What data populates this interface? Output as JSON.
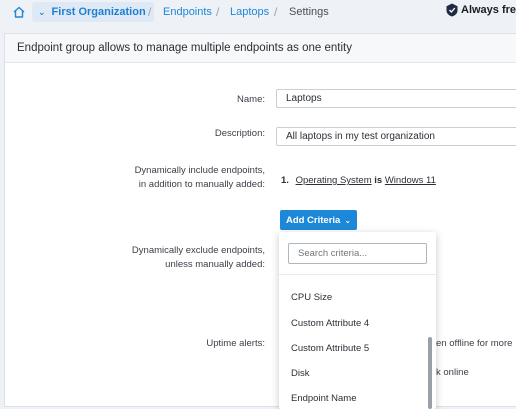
{
  "breadcrumb": {
    "organization": "First Organization",
    "items": [
      "Endpoints",
      "Laptops",
      "Settings"
    ],
    "separator": "/"
  },
  "plan_badge": "Always free:",
  "panel": {
    "title": "Endpoint group allows to manage multiple endpoints as one entity"
  },
  "form": {
    "name_label": "Name:",
    "name_value": "Laptops",
    "description_label": "Description:",
    "description_value": "All laptops in my test organization",
    "include_label_line1": "Dynamically include endpoints,",
    "include_label_line2": "in addition to manually added:",
    "include_rule": {
      "index": "1.",
      "field": "Operating System",
      "operator": "is",
      "value": "Windows 11"
    },
    "add_criteria_label": "Add Criteria",
    "exclude_label_line1": "Dynamically exclude endpoints,",
    "exclude_label_line2": "unless manually added:",
    "uptime_label": "Uptime alerts:",
    "uptime_text_1": "en offline for more",
    "uptime_text_2": "k online"
  },
  "dropdown": {
    "search_placeholder": "Search criteria...",
    "options": [
      "CPU Size",
      "Custom Attribute 4",
      "Custom Attribute 5",
      "Disk",
      "Endpoint Name"
    ]
  },
  "colors": {
    "accent": "#1e88d8",
    "page_bg": "#eef1f5",
    "panel_header_bg": "#f6f8fa"
  }
}
